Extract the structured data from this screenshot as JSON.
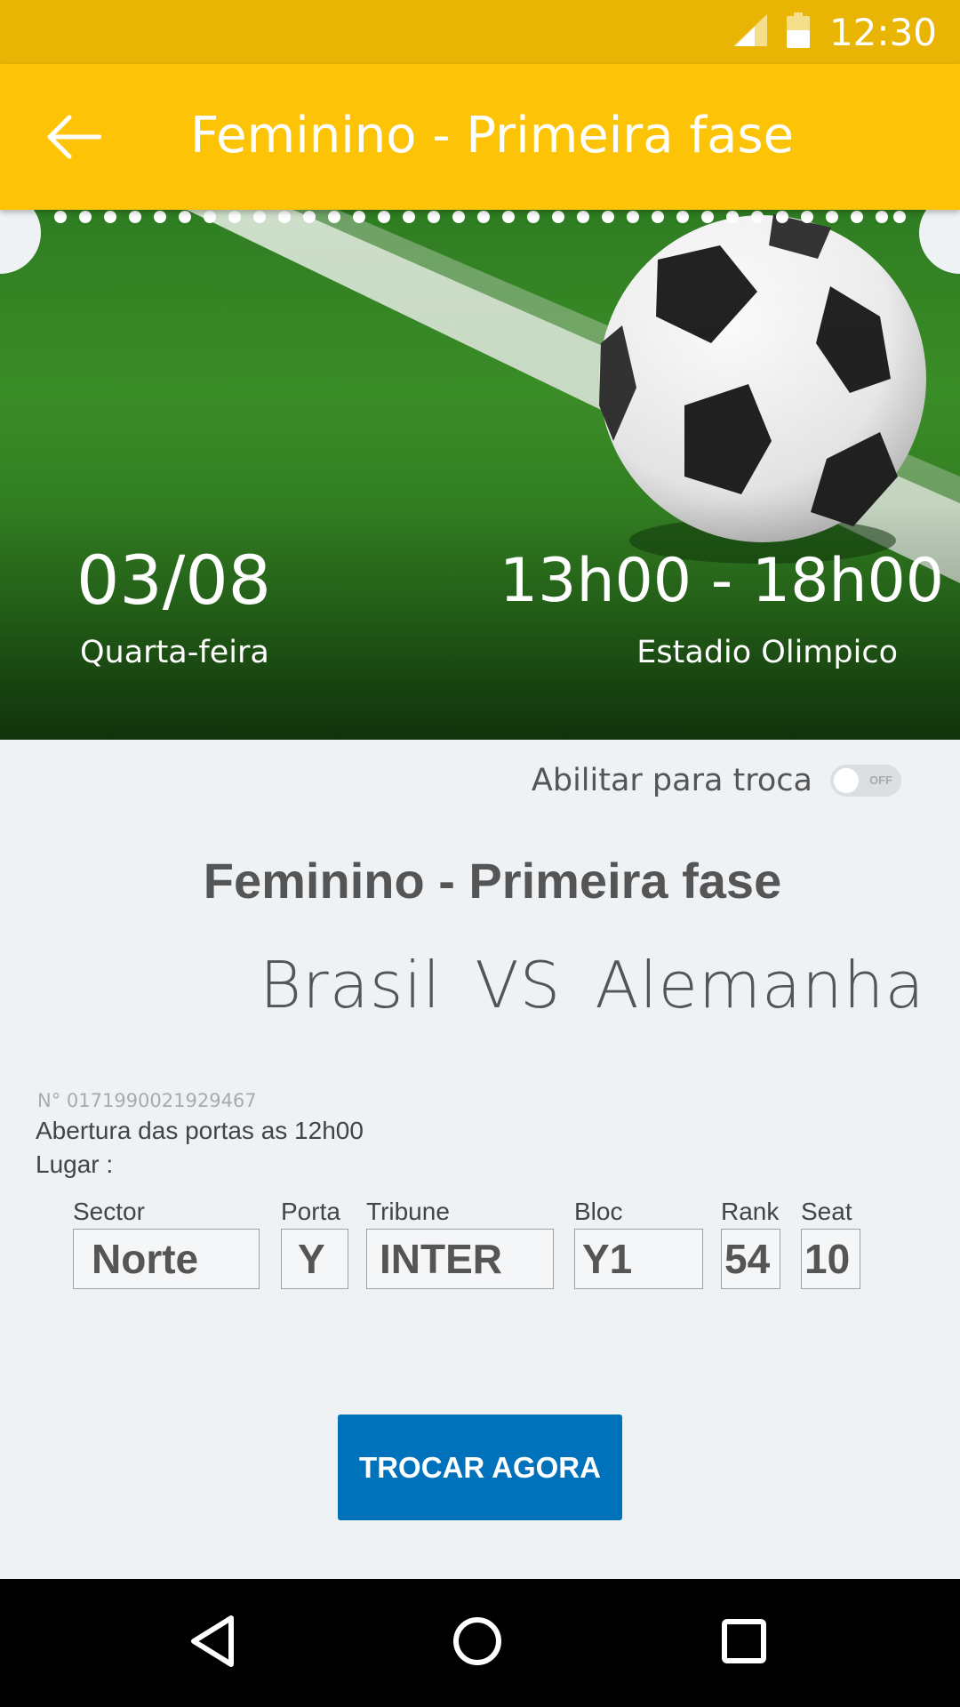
{
  "status_bar": {
    "time": "12:30"
  },
  "app_bar": {
    "title": "Feminino - Primeira fase"
  },
  "hero": {
    "date": "03/08",
    "day": "Quarta-feira",
    "time": "13h00 - 18h00",
    "venue": "Estadio Olimpico"
  },
  "exchange_toggle": {
    "label": "Abilitar para troca",
    "state": "OFF"
  },
  "event": {
    "title": "Feminino - Primeira fase",
    "team_home": "Brasil",
    "versus": "VS",
    "team_away": "Alemanha"
  },
  "ticket": {
    "number": "N° 0171990021929467",
    "doors": "Abertura das portas as 12h00",
    "place_label": "Lugar :",
    "fields": [
      {
        "label": "Sector",
        "value": "Norte"
      },
      {
        "label": "Porta",
        "value": "Y"
      },
      {
        "label": "Tribune",
        "value": "INTER"
      },
      {
        "label": "Bloc",
        "value": "Y1"
      },
      {
        "label": "Rank",
        "value": "54"
      },
      {
        "label": "Seat",
        "value": "10"
      }
    ]
  },
  "cta": {
    "label": "TROCAR AGORA"
  },
  "colors": {
    "status_bar": "#e9b505",
    "app_bar": "#fdc306",
    "button": "#0071bb",
    "background": "#eff2f5"
  }
}
